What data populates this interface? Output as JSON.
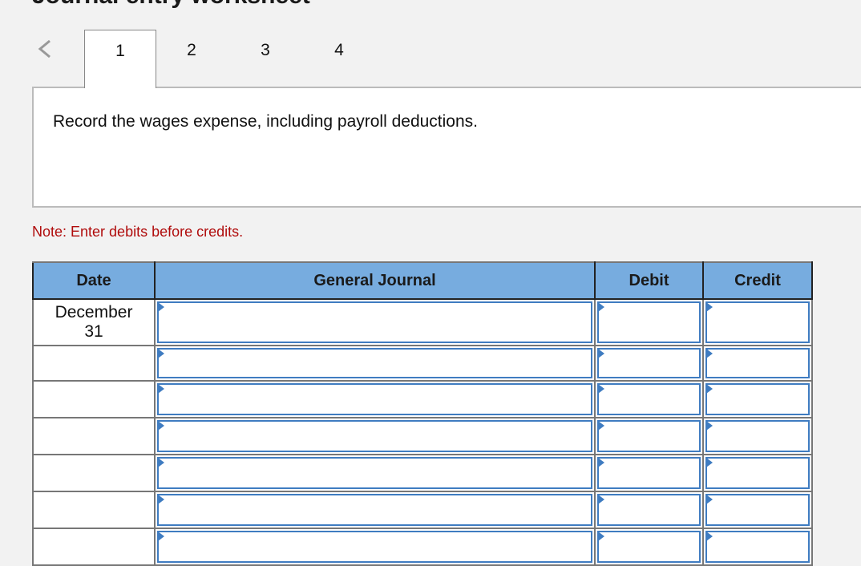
{
  "title": "Journal entry worksheet",
  "nav": {
    "back_icon": "chevron-left-icon",
    "tabs": [
      "1",
      "2",
      "3",
      "4"
    ],
    "active_tab": "1"
  },
  "instruction": "Record the wages expense, including payroll deductions.",
  "note": "Note: Enter debits before credits.",
  "table": {
    "headers": {
      "date": "Date",
      "journal": "General Journal",
      "debit": "Debit",
      "credit": "Credit"
    },
    "rows": [
      {
        "date": "December\n31",
        "journal": "",
        "debit": "",
        "credit": ""
      },
      {
        "date": "",
        "journal": "",
        "debit": "",
        "credit": ""
      },
      {
        "date": "",
        "journal": "",
        "debit": "",
        "credit": ""
      },
      {
        "date": "",
        "journal": "",
        "debit": "",
        "credit": ""
      },
      {
        "date": "",
        "journal": "",
        "debit": "",
        "credit": ""
      },
      {
        "date": "",
        "journal": "",
        "debit": "",
        "credit": ""
      },
      {
        "date": "",
        "journal": "",
        "debit": "",
        "credit": ""
      }
    ]
  },
  "colors": {
    "header_bg": "#77acdf",
    "input_border": "#3f7cc1",
    "note": "#b00c0c"
  }
}
